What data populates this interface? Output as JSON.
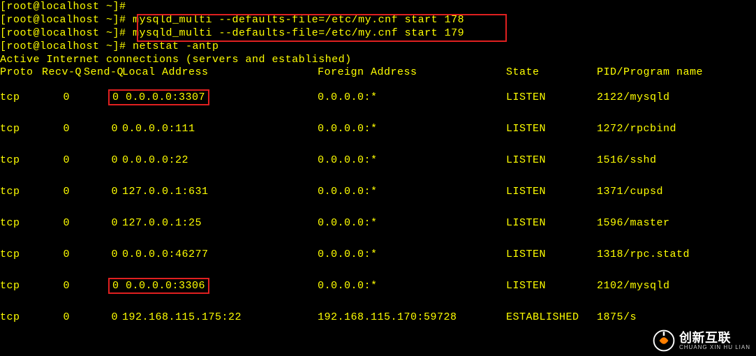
{
  "prompts": {
    "p1": "[root@localhost ~]# ",
    "p2": "[root@localhost ~]# ",
    "p3": "[root@localhost ~]# ",
    "p4": "[root@localhost ~]# "
  },
  "commands": {
    "c2": "mysqld_multi --defaults-file=/etc/my.cnf start 178",
    "c3": "mysqld_multi --defaults-file=/etc/my.cnf start 179",
    "c4": "netstat -antp"
  },
  "active_line": "Active Internet connections (servers and established)",
  "headers": {
    "proto": "Proto",
    "recvq": "Recv-Q",
    "sendq": "Send-Q",
    "local": "Local Address",
    "foreign": "Foreign Address",
    "state": "State",
    "pid": "PID/Program name"
  },
  "rows": [
    {
      "proto": "tcp",
      "recvq": "0",
      "sendq": "0",
      "local": "0.0.0.0:3307",
      "foreign": "0.0.0.0:*",
      "state": "LISTEN",
      "pid": "2122/mysqld",
      "boxed": true
    },
    {
      "proto": "tcp",
      "recvq": "0",
      "sendq": "0",
      "local": "0.0.0.0:111",
      "foreign": "0.0.0.0:*",
      "state": "LISTEN",
      "pid": "1272/rpcbind",
      "boxed": false
    },
    {
      "proto": "tcp",
      "recvq": "0",
      "sendq": "0",
      "local": "0.0.0.0:22",
      "foreign": "0.0.0.0:*",
      "state": "LISTEN",
      "pid": "1516/sshd",
      "boxed": false
    },
    {
      "proto": "tcp",
      "recvq": "0",
      "sendq": "0",
      "local": "127.0.0.1:631",
      "foreign": "0.0.0.0:*",
      "state": "LISTEN",
      "pid": "1371/cupsd",
      "boxed": false
    },
    {
      "proto": "tcp",
      "recvq": "0",
      "sendq": "0",
      "local": "127.0.0.1:25",
      "foreign": "0.0.0.0:*",
      "state": "LISTEN",
      "pid": "1596/master",
      "boxed": false
    },
    {
      "proto": "tcp",
      "recvq": "0",
      "sendq": "0",
      "local": "0.0.0.0:46277",
      "foreign": "0.0.0.0:*",
      "state": "LISTEN",
      "pid": "1318/rpc.statd",
      "boxed": false
    },
    {
      "proto": "tcp",
      "recvq": "0",
      "sendq": "0",
      "local": "0.0.0.0:3306",
      "foreign": "0.0.0.0:*",
      "state": "LISTEN",
      "pid": "2102/mysqld",
      "boxed": true
    },
    {
      "proto": "tcp",
      "recvq": "0",
      "sendq": "0",
      "local": "192.168.115.175:22",
      "foreign": "192.168.115.170:59728",
      "state": "ESTABLISHED",
      "pid": "1875/s",
      "boxed": false
    }
  ],
  "watermark": {
    "title": "创新互联",
    "sub": "CHUANG XIN HU LIAN"
  }
}
